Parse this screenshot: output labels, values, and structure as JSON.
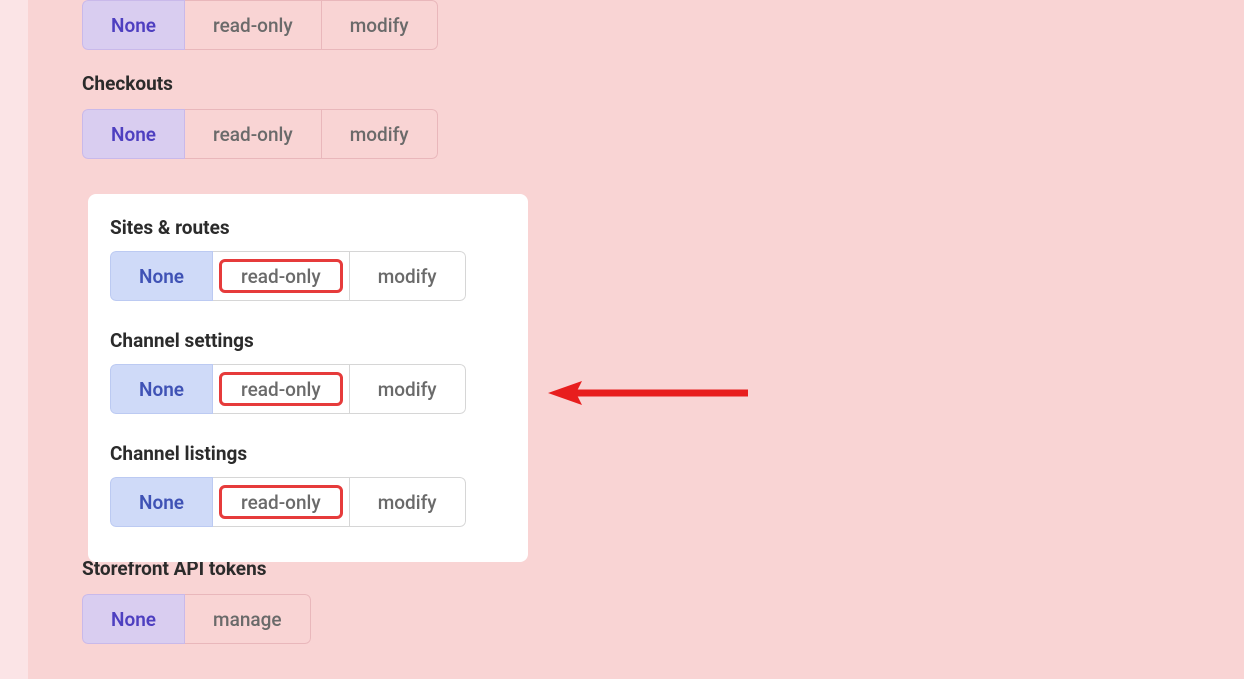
{
  "labels": {
    "none": "None",
    "read_only": "read-only",
    "modify": "modify",
    "manage": "manage"
  },
  "groups": {
    "top_unnamed": {
      "selected": "none",
      "options": [
        "none",
        "read_only",
        "modify"
      ]
    },
    "checkouts": {
      "title": "Checkouts",
      "selected": "none",
      "options": [
        "none",
        "read_only",
        "modify"
      ]
    },
    "sites_routes": {
      "title": "Sites & routes",
      "selected": "none",
      "highlight_option": "read_only",
      "options": [
        "none",
        "read_only",
        "modify"
      ]
    },
    "channel_settings": {
      "title": "Channel settings",
      "selected": "none",
      "highlight_option": "read_only",
      "options": [
        "none",
        "read_only",
        "modify"
      ]
    },
    "channel_listings": {
      "title": "Channel listings",
      "selected": "none",
      "highlight_option": "read_only",
      "options": [
        "none",
        "read_only",
        "modify"
      ]
    },
    "storefront_api_tokens": {
      "title": "Storefront API tokens",
      "selected": "none",
      "options": [
        "none",
        "manage"
      ]
    }
  },
  "annotation": {
    "arrow_color": "#e81e1e",
    "highlight_color": "#e63b3b"
  }
}
